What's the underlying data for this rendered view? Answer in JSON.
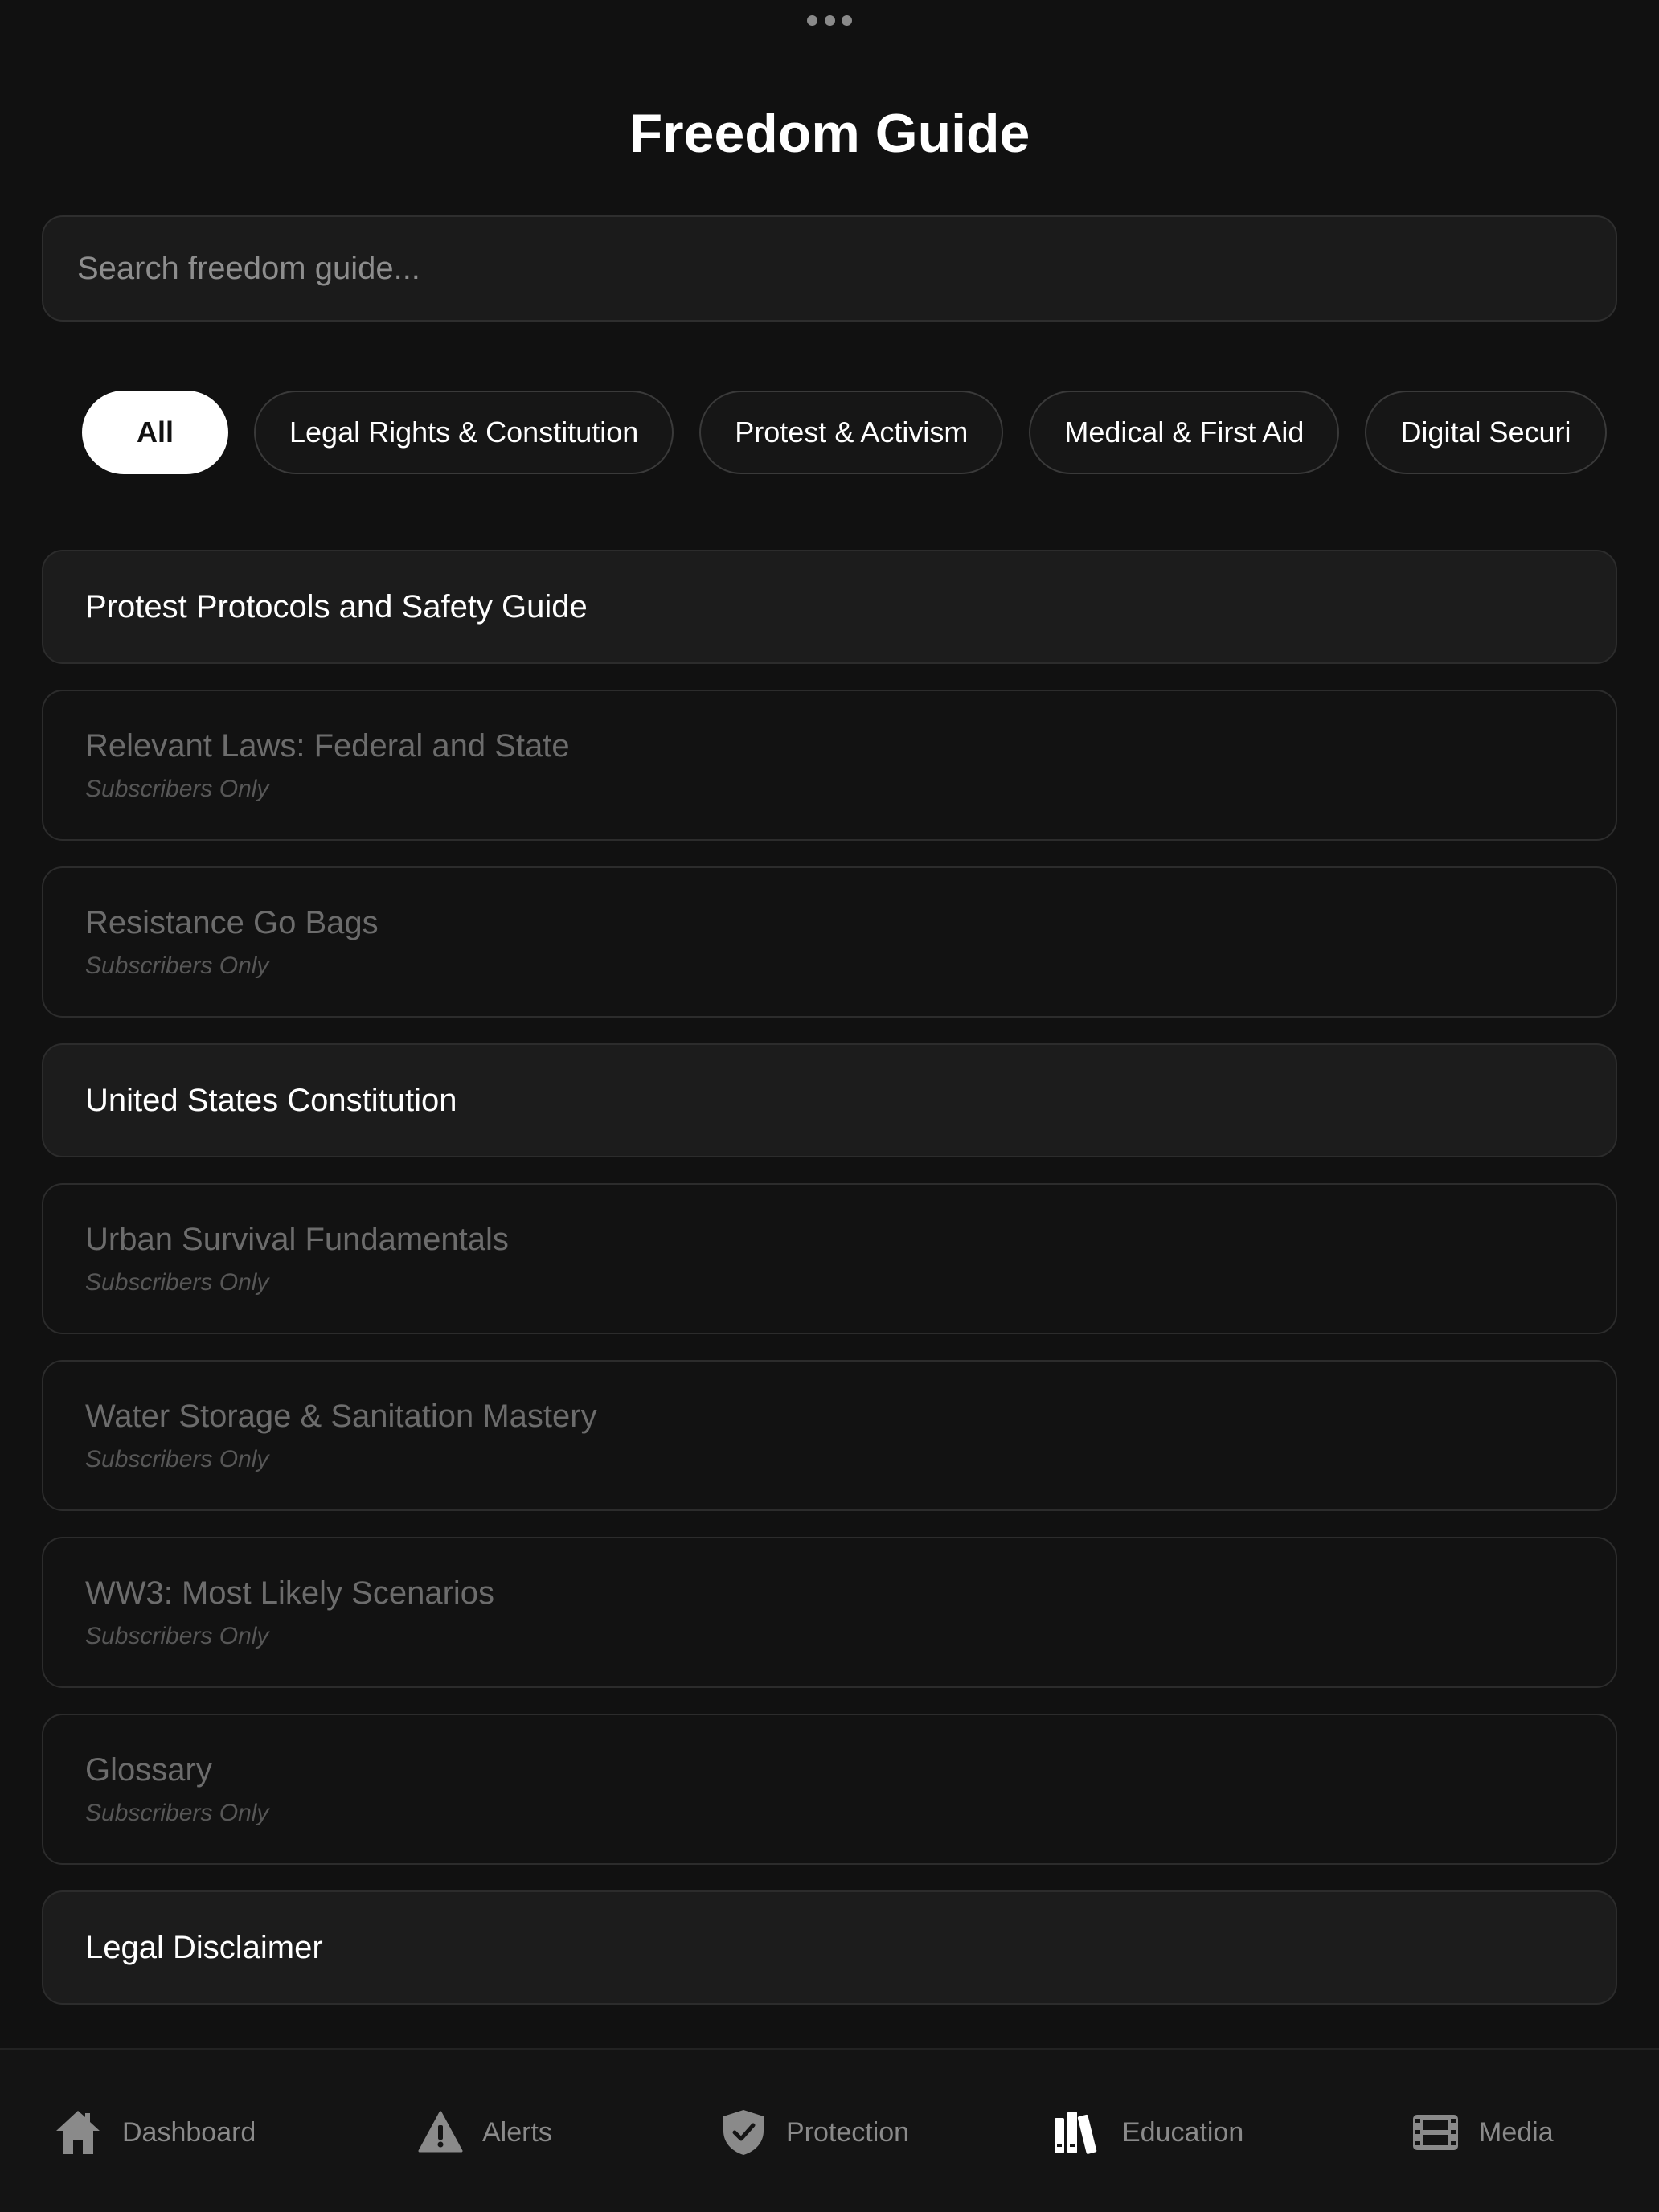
{
  "header": {
    "title": "Freedom Guide"
  },
  "search": {
    "placeholder": "Search freedom guide..."
  },
  "categories": [
    {
      "label": "All",
      "active": true
    },
    {
      "label": "Legal Rights & Constitution",
      "active": false
    },
    {
      "label": "Protest & Activism",
      "active": false
    },
    {
      "label": "Medical & First Aid",
      "active": false
    },
    {
      "label": "Digital Securi",
      "active": false
    }
  ],
  "guides": [
    {
      "title": "Protest Protocols and Safety Guide",
      "subtitle": "",
      "locked": false
    },
    {
      "title": "Relevant Laws: Federal and State",
      "subtitle": "Subscribers Only",
      "locked": true
    },
    {
      "title": "Resistance Go Bags",
      "subtitle": "Subscribers Only",
      "locked": true
    },
    {
      "title": "United States Constitution",
      "subtitle": "",
      "locked": false
    },
    {
      "title": "Urban Survival Fundamentals",
      "subtitle": "Subscribers Only",
      "locked": true
    },
    {
      "title": "Water Storage & Sanitation Mastery",
      "subtitle": "Subscribers Only",
      "locked": true
    },
    {
      "title": "WW3: Most Likely Scenarios",
      "subtitle": "Subscribers Only",
      "locked": true
    },
    {
      "title": "Glossary",
      "subtitle": "Subscribers Only",
      "locked": true
    },
    {
      "title": "Legal Disclaimer",
      "subtitle": "",
      "locked": false
    }
  ],
  "tabs": [
    {
      "label": "Dashboard",
      "icon": "house-icon",
      "active": false
    },
    {
      "label": "Alerts",
      "icon": "warning-triangle-icon",
      "active": false
    },
    {
      "label": "Protection",
      "icon": "shield-check-icon",
      "active": false
    },
    {
      "label": "Education",
      "icon": "books-icon",
      "active": true
    },
    {
      "label": "Media",
      "icon": "film-icon",
      "active": false
    }
  ],
  "colors": {
    "background": "#111111",
    "card_open": "#1c1c1c",
    "card_locked": "#121212",
    "text_primary": "#ffffff",
    "text_muted": "#6c6c6c",
    "tab_inactive": "#8a8a8a"
  }
}
